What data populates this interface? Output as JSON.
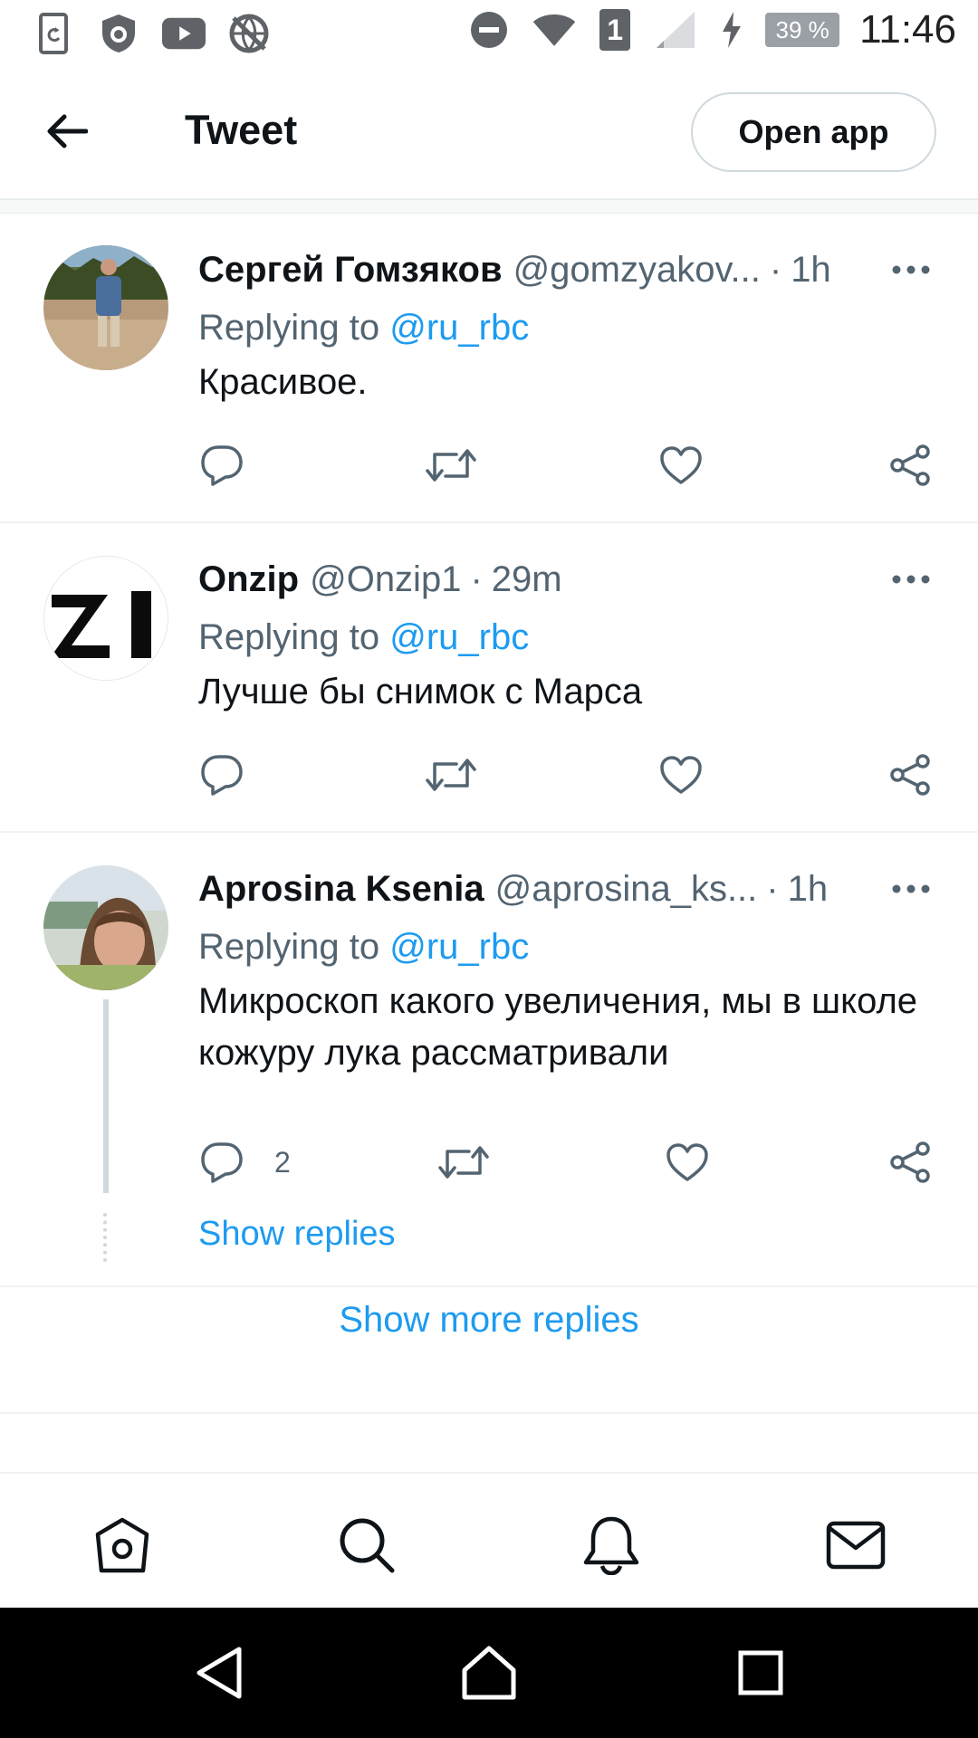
{
  "status_bar": {
    "time": "11:46",
    "battery": "39 %",
    "sim_label": "1",
    "left_icons": [
      "sync-icon",
      "shield-icon",
      "youtube-icon",
      "no-network-icon"
    ],
    "right_icons": [
      "dnd-icon",
      "wifi-icon",
      "sim-icon",
      "signal-icon",
      "charging-icon"
    ]
  },
  "header": {
    "title": "Tweet",
    "open_app_label": "Open app"
  },
  "tweets": [
    {
      "name": "Сергей Гомзяков",
      "handle": "@gomzyakov...",
      "time": "1h",
      "replying_prefix": "Replying to",
      "replying_to": "@ru_rbc",
      "text": "Красивое.",
      "reply_count": ""
    },
    {
      "name": "Onzip",
      "handle": "@Onzip1",
      "time": "29m",
      "replying_prefix": "Replying to",
      "replying_to": "@ru_rbc",
      "text": "Лучше бы снимок с Марса",
      "reply_count": ""
    },
    {
      "name": "Aprosina Ksenia",
      "handle": "@aprosina_ks...",
      "time": "1h",
      "replying_prefix": "Replying to",
      "replying_to": "@ru_rbc",
      "text": "Микроскоп какого увеличения, мы в школе кожуру лука рассматривали",
      "reply_count": "2"
    }
  ],
  "thread": {
    "show_replies_label": "Show replies",
    "show_more_label": "Show more replies"
  },
  "separator": "·",
  "bottom_nav": [
    "home-icon",
    "search-icon",
    "notifications-icon",
    "messages-icon"
  ],
  "android_nav": [
    "back-icon",
    "home-icon",
    "recents-icon"
  ],
  "colors": {
    "accent": "#1d9bf0",
    "text": "#0f1419",
    "secondary": "#536471",
    "border": "#eff3f4"
  }
}
